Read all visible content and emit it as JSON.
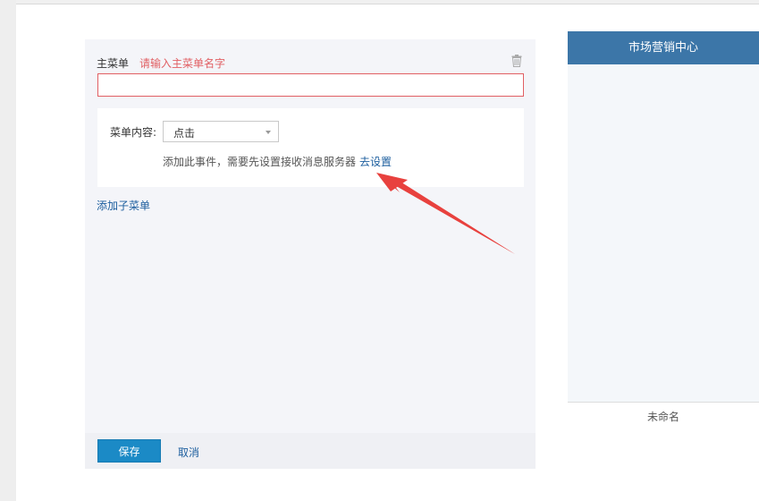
{
  "editor": {
    "menu_name_label": "主菜单",
    "menu_name_hint": "请输入主菜单名字",
    "name_input": {
      "value": "",
      "placeholder": ""
    },
    "content_label": "菜单内容:",
    "content_select_value": "点击",
    "info_text": "添加此事件，需要先设置接收消息服务器",
    "info_link": "去设置",
    "add_submenu": "添加子菜单",
    "save_label": "保存",
    "cancel_label": "取消"
  },
  "preview": {
    "header_title": "市场营销中心",
    "footer_tab": "未命名"
  },
  "icons": {
    "trash": "trash-icon",
    "dropdown": "chevron-down-icon",
    "annotation": "arrow-icon"
  },
  "colors": {
    "accent": "#1b8ac6",
    "link": "#1c5e9e",
    "error": "#e15f63",
    "header": "#3c76a8",
    "annotation_arrow": "#e8413e"
  }
}
